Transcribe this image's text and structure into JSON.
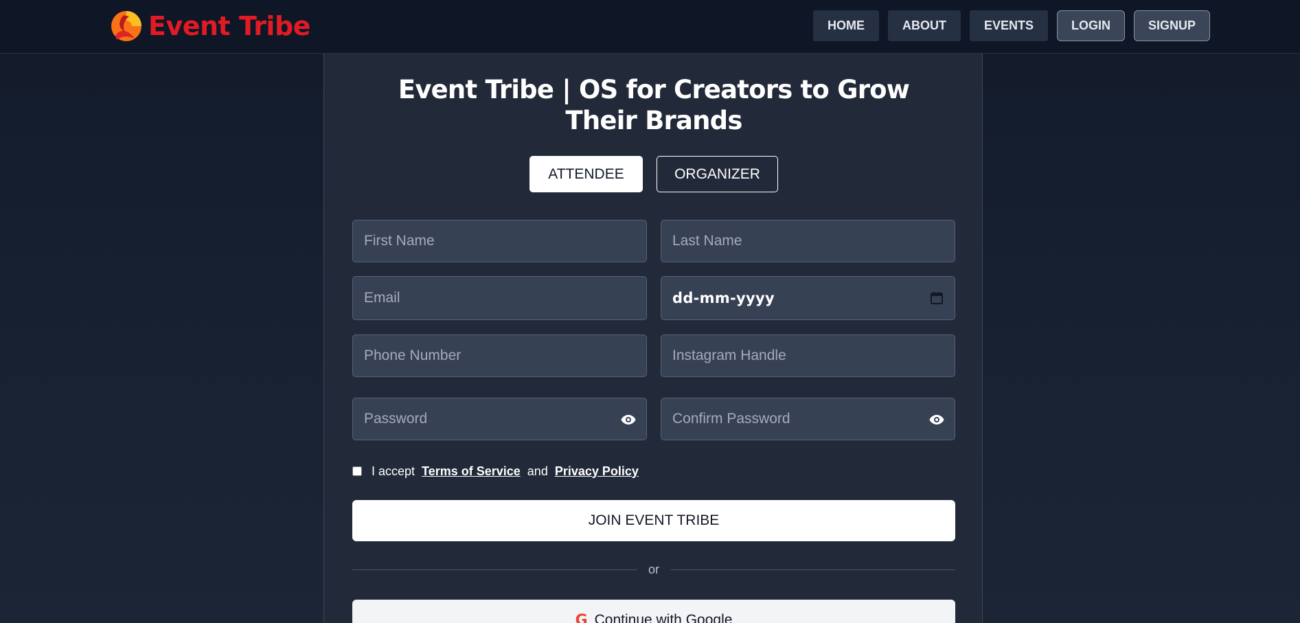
{
  "brand": {
    "name": "Event Tribe",
    "color": "#e01b24"
  },
  "nav": {
    "items": [
      {
        "label": "HOME"
      },
      {
        "label": "ABOUT"
      },
      {
        "label": "EVENTS"
      },
      {
        "label": "LOGIN"
      },
      {
        "label": "SIGNUP"
      }
    ]
  },
  "form": {
    "title": "Event Tribe | OS for Creators to Grow Their Brands",
    "roles": {
      "attendee": "ATTENDEE",
      "organizer": "ORGANIZER",
      "selected": "ATTENDEE"
    },
    "fields": {
      "first_name": {
        "placeholder": "First Name",
        "value": ""
      },
      "last_name": {
        "placeholder": "Last Name",
        "value": ""
      },
      "email": {
        "placeholder": "Email",
        "value": ""
      },
      "dob": {
        "display": "dd-mm-yyyy",
        "icon": "calendar-icon"
      },
      "phone": {
        "placeholder": "Phone Number",
        "value": ""
      },
      "instagram": {
        "placeholder": "Instagram Handle",
        "value": ""
      },
      "password": {
        "placeholder": "Password",
        "value": "",
        "icon": "eye-icon"
      },
      "confirm_password": {
        "placeholder": "Confirm Password",
        "value": "",
        "icon": "eye-icon"
      }
    },
    "terms": {
      "prefix": "I accept",
      "tos": "Terms of Service",
      "and": "and",
      "privacy": "Privacy Policy",
      "checked": false
    },
    "submit_label": "JOIN EVENT TRIBE",
    "divider_text": "or",
    "google_label": "Continue with Google",
    "google_icon": "G"
  }
}
